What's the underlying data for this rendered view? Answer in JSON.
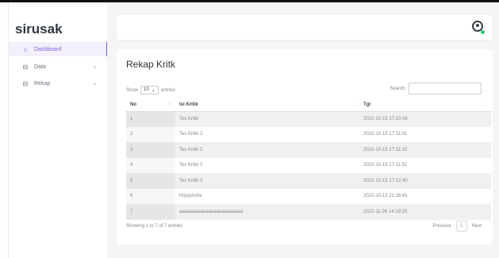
{
  "brand": "sirusak",
  "sidebar": {
    "items": [
      {
        "label": "Dashboard",
        "icon": "home-icon",
        "active": true,
        "chevron": ""
      },
      {
        "label": "Data",
        "icon": "grid-icon",
        "active": false,
        "chevron": "›"
      },
      {
        "label": "Rekap",
        "icon": "grid-icon",
        "active": false,
        "chevron": "›"
      }
    ]
  },
  "header": {
    "user_icon": "user-circle-icon"
  },
  "card": {
    "title": "Rekap Kritk",
    "show_label": "Show",
    "entries_value": "10",
    "entries_label": "entries",
    "search_label": "Search:",
    "columns": [
      "No",
      "Isi Kritik",
      "Tgl"
    ],
    "rows": [
      {
        "no": "1",
        "isi": "Tes Kritik",
        "tgl": "2022-10-15 17:10:06"
      },
      {
        "no": "2",
        "isi": "Tes Kritik 2",
        "tgl": "2022-10-15 17:11:01"
      },
      {
        "no": "3",
        "isi": "Tes Kritik 2",
        "tgl": "2022-10-15 17:11:10"
      },
      {
        "no": "4",
        "isi": "Tes Kritik 2",
        "tgl": "2022-10-15 17:11:51"
      },
      {
        "no": "5",
        "isi": "Tes Kritik 3",
        "tgl": "2022-10-15 17:12:40"
      },
      {
        "no": "6",
        "isi": "Hsjsjshshs",
        "tgl": "2022-10-15 21:28:41"
      },
      {
        "no": "7",
        "isi": "aaaaaaaaaaaaaaaaaaaaaaaa",
        "tgl": "2022-11-26 14:19:20"
      }
    ],
    "info": "Showing 1 to 7 of 7 entries",
    "pager": {
      "prev": "Previous",
      "page": "1",
      "next": "Next"
    }
  },
  "colors": {
    "accent": "#7a5cdb",
    "status_online": "#2ecc71"
  }
}
